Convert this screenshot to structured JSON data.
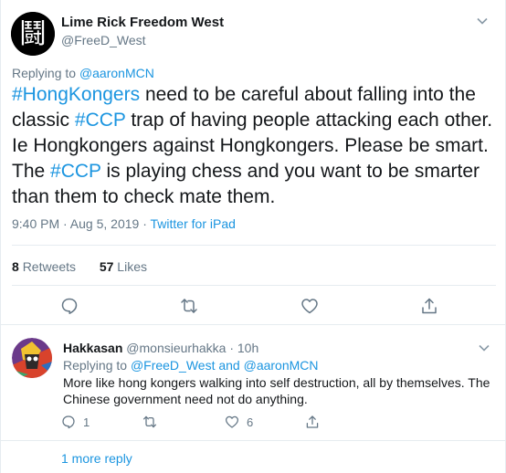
{
  "tweet": {
    "author_name": "Lime Rick Freedom West",
    "author_handle": "@FreeD_West",
    "avatar_glyph": "鬪",
    "replying_prefix": "Replying to",
    "replying_to": "@aaronMCN",
    "text_parts": [
      {
        "t": "#HongKongers",
        "h": true
      },
      {
        "t": " need to be careful about falling into the classic ",
        "h": false
      },
      {
        "t": "#CCP",
        "h": true
      },
      {
        "t": " trap of having people attacking each other. Ie Hongkongers against Hongkongers. Please be smart. The ",
        "h": false
      },
      {
        "t": "#CCP",
        "h": true
      },
      {
        "t": " is playing chess and you want to be smarter than them to check mate them.",
        "h": false
      }
    ],
    "time": "9:40 PM · Aug 5, 2019",
    "dot": "·",
    "source": "Twitter for iPad",
    "retweets_count": "8",
    "retweets_label": "Retweets",
    "likes_count": "57",
    "likes_label": "Likes"
  },
  "reply": {
    "author_name": "Hakkasan",
    "author_handle": "@monsieurhakka",
    "age": "· 10h",
    "replying_prefix": "Replying to",
    "replying_users": "@FreeD_West and @aaronMCN",
    "text": "More like hong kongers walking into self destruction, all by themselves. The Chinese government need not do anything.",
    "reply_count": "1",
    "like_count": "6"
  },
  "more_replies": "1 more reply",
  "colors": {
    "link": "#1b95e0",
    "secondary": "#657786",
    "text": "#14171a",
    "border": "#e6ecf0"
  }
}
